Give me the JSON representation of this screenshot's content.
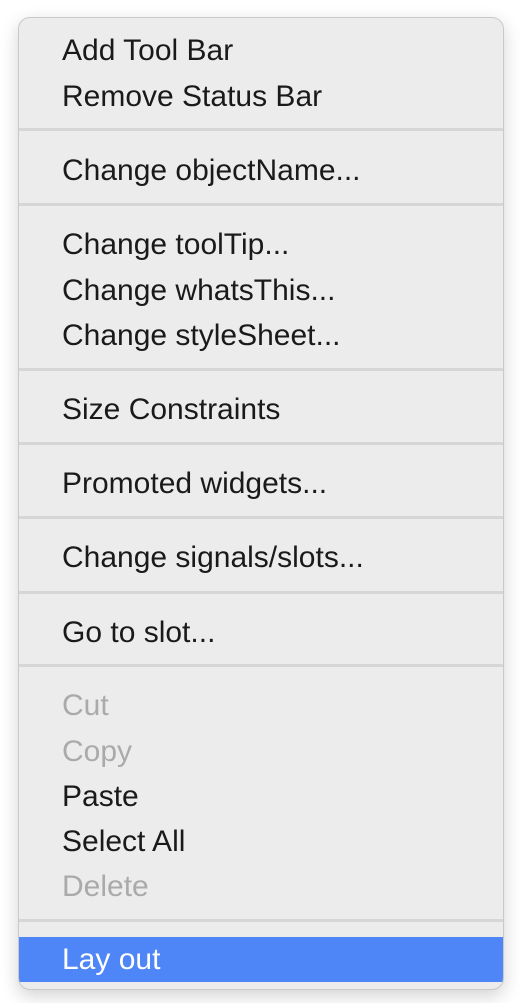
{
  "menu": {
    "groups": [
      {
        "items": [
          {
            "label": "Add Tool Bar"
          },
          {
            "label": "Remove Status Bar"
          }
        ]
      },
      {
        "items": [
          {
            "label": "Change objectName..."
          }
        ]
      },
      {
        "items": [
          {
            "label": "Change toolTip..."
          },
          {
            "label": "Change whatsThis..."
          },
          {
            "label": "Change styleSheet..."
          }
        ]
      },
      {
        "items": [
          {
            "label": "Size Constraints"
          }
        ]
      },
      {
        "items": [
          {
            "label": "Promoted widgets..."
          }
        ]
      },
      {
        "items": [
          {
            "label": "Change signals/slots..."
          }
        ]
      },
      {
        "items": [
          {
            "label": "Go to slot..."
          }
        ]
      },
      {
        "items": [
          {
            "label": "Cut",
            "enabled": false
          },
          {
            "label": "Copy",
            "enabled": false
          },
          {
            "label": "Paste",
            "enabled": true
          },
          {
            "label": "Select All",
            "enabled": true
          },
          {
            "label": "Delete",
            "enabled": false
          }
        ]
      },
      {
        "items": [
          {
            "label": "Lay out",
            "highlighted": true
          }
        ]
      }
    ],
    "colors": {
      "background": "#ececec",
      "highlight": "#4f86f7",
      "text": "#1a1a1a",
      "disabled_text": "#aaaaaa",
      "separator": "#d6d6d6"
    }
  }
}
